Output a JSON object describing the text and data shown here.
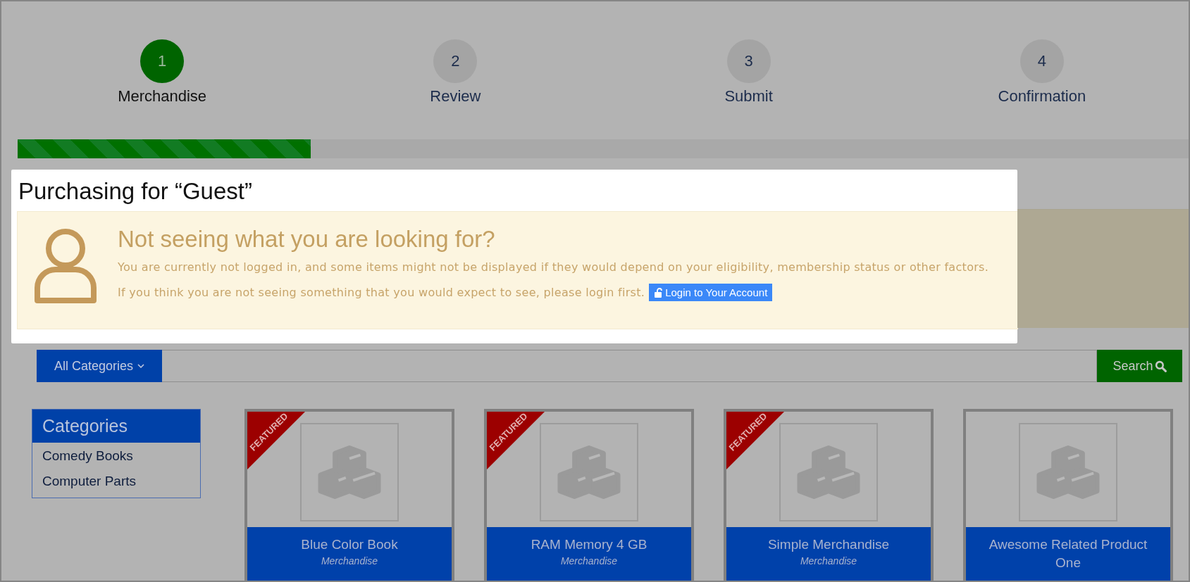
{
  "steps": [
    {
      "number": "1",
      "label": "Merchandise",
      "selected": true
    },
    {
      "number": "2",
      "label": "Review",
      "selected": false
    },
    {
      "number": "3",
      "label": "Submit",
      "selected": false
    },
    {
      "number": "4",
      "label": "Confirmation",
      "selected": false
    }
  ],
  "progress": {
    "level": 0.25
  },
  "purchasing": {
    "title": "Purchasing for “Guest”",
    "alert": {
      "heading": "Not seeing what you are looking for?",
      "message": "You are currently not logged in, and some items might not be displayed if they would depend on your eligibility, membership status or other factors.",
      "hint": "If you think you are not seeing something that you would expect to see, please login first.",
      "login_button": "Login to Your Account"
    }
  },
  "search": {
    "category_button": "All Categories",
    "button": "Search"
  },
  "sidebar": {
    "title": "Categories",
    "items": [
      "Comedy Books",
      "Computer Parts"
    ]
  },
  "products": [
    {
      "name": "Blue Color Book",
      "category": "Merchandise",
      "featured": true,
      "ribbon": "FEATURED"
    },
    {
      "name": "RAM Memory 4 GB",
      "category": "Merchandise",
      "featured": true,
      "ribbon": "FEATURED"
    },
    {
      "name": "Simple Merchandise",
      "category": "Merchandise",
      "featured": true,
      "ribbon": "FEATURED"
    },
    {
      "name": "Awesome Related Product One",
      "featured": false
    }
  ]
}
